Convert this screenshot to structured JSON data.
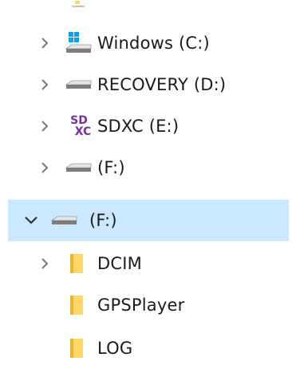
{
  "tree": {
    "items": [
      {
        "label": "Windows (C:)",
        "icon": "windows-drive-icon",
        "expanded": false
      },
      {
        "label": "RECOVERY (D:)",
        "icon": "hard-drive-icon",
        "expanded": false
      },
      {
        "label": "SDXC (E:)",
        "icon": "sd-card-icon",
        "expanded": false
      },
      {
        "label": " (F:)",
        "icon": "removable-drive-icon",
        "expanded": false
      },
      {
        "label": "(F:)",
        "icon": "removable-drive-icon",
        "expanded": true,
        "selected": true
      },
      {
        "label": "DCIM",
        "icon": "folder-icon",
        "expanded": false
      },
      {
        "label": "GPSPlayer",
        "icon": "folder-icon"
      },
      {
        "label": "LOG",
        "icon": "folder-icon"
      }
    ],
    "sd_icon_text_top": "SD",
    "sd_icon_text_bottom": "XC"
  },
  "colors": {
    "selection": "#cce8ff",
    "folder": "#ffd766",
    "folder_dark": "#e8b43a",
    "chevron": "#7a7a7a",
    "sd_purple": "#7a2e9e",
    "windows_blue": "#00a4ef"
  }
}
